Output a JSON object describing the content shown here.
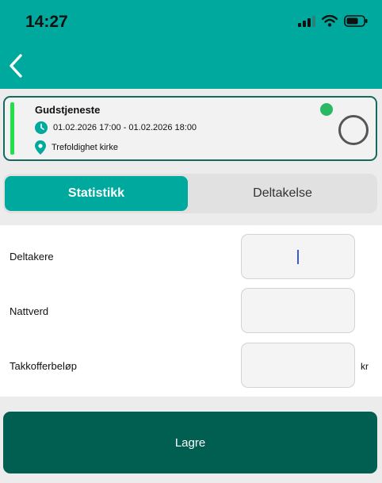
{
  "status_bar": {
    "time": "14:27"
  },
  "event": {
    "title": "Gudstjeneste",
    "datetime": "01.02.2026 17:00 - 01.02.2026 18:00",
    "location": "Trefoldighet kirke"
  },
  "tabs": [
    {
      "label": "Statistikk",
      "active": true
    },
    {
      "label": "Deltakelse",
      "active": false
    }
  ],
  "form": {
    "fields": [
      {
        "label": "Deltakere",
        "value": ""
      },
      {
        "label": "Nattverd",
        "value": ""
      },
      {
        "label": "Takkofferbeløp",
        "value": "",
        "unit": "kr"
      }
    ]
  },
  "actions": {
    "save_label": "Lagre"
  },
  "colors": {
    "brand": "#00a99d",
    "card_border": "#16695c",
    "event_bar": "#22e04a",
    "status_dot": "#2bb864",
    "save_button": "#005f50"
  },
  "icons": {
    "back": "chevron-left-icon",
    "time": "clock-icon",
    "location": "map-pin-icon",
    "signal": "cellular-signal-icon",
    "wifi": "wifi-icon",
    "battery": "battery-icon"
  }
}
